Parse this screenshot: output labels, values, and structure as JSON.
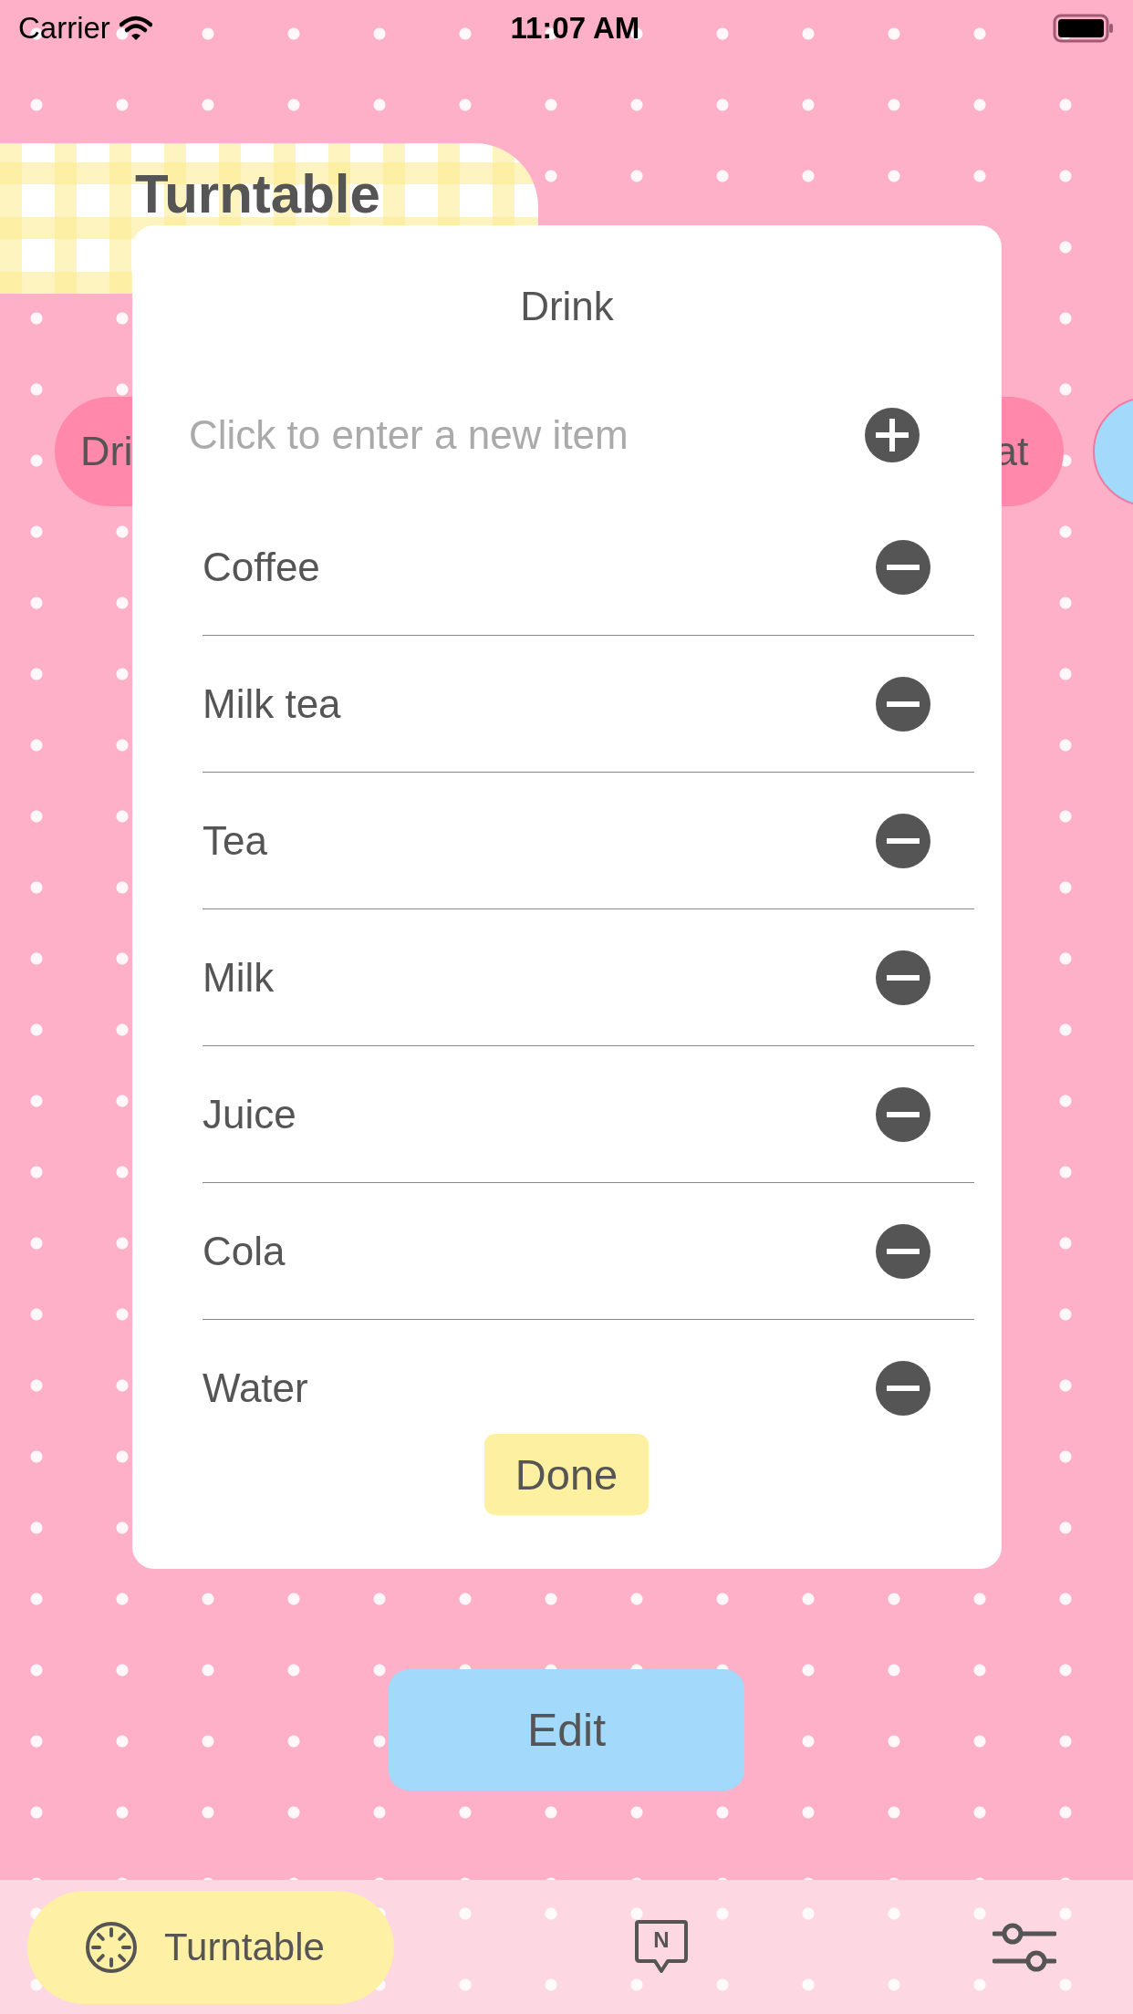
{
  "status_bar": {
    "carrier": "Carrier",
    "time": "11:07 AM"
  },
  "header": {
    "title": "Turntable"
  },
  "categories": [
    {
      "label": "Dri",
      "color": "#ff88ab"
    },
    {
      "label": "at",
      "color": "#ff88ab"
    },
    {
      "color": "#a3d9fb"
    }
  ],
  "dialog": {
    "title": "Drink",
    "new_item": {
      "placeholder": "Click to enter a new item"
    },
    "items": [
      "Coffee",
      "Milk tea",
      "Tea",
      "Milk",
      "Juice",
      "Cola",
      "Water"
    ],
    "done_button": "Done"
  },
  "edit_button": "Edit",
  "tabs": [
    {
      "kind": "dial",
      "label": "Turntable",
      "selected": true
    },
    {
      "kind": "note",
      "glyph": "N",
      "selected": false
    },
    {
      "kind": "sliders",
      "selected": false
    }
  ]
}
